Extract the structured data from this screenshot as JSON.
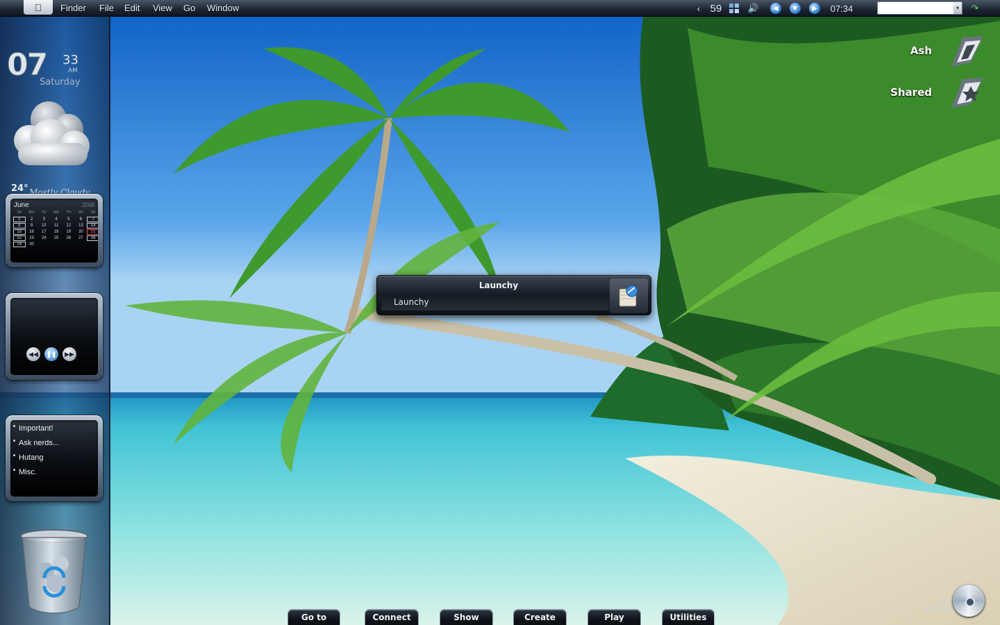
{
  "menubar": {
    "apple_icon": "apple-icon",
    "items": [
      "Finder",
      "File",
      "Edit",
      "View",
      "Go",
      "Window"
    ],
    "tray": {
      "count": "59",
      "clock": "07:34",
      "icons": [
        "chevron-left-icon",
        "spaces-icon",
        "volume-icon",
        "back-icon",
        "download-icon",
        "forward-icon",
        "refresh-icon"
      ]
    },
    "search": {
      "value": ""
    }
  },
  "clock_widget": {
    "hour": "07",
    "minute": "33",
    "ampm": "AM",
    "day": "Saturday"
  },
  "weather_widget": {
    "temp": "24°",
    "condition": "Mostly Cloudy"
  },
  "calendar_widget": {
    "month": "June",
    "year": "2008",
    "weekdays": [
      "SU",
      "MO",
      "TU",
      "WE",
      "TH",
      "FR",
      "SA"
    ],
    "weeks": [
      [
        "1",
        "2",
        "3",
        "4",
        "5",
        "6",
        "7"
      ],
      [
        "8",
        "9",
        "10",
        "11",
        "12",
        "13",
        "14"
      ],
      [
        "15",
        "16",
        "17",
        "18",
        "19",
        "20",
        "21"
      ],
      [
        "22",
        "23",
        "24",
        "25",
        "26",
        "27",
        "28"
      ],
      [
        "29",
        "30",
        "",
        "",
        "",
        "",
        ""
      ]
    ],
    "today": "21"
  },
  "player_widget": {
    "buttons": [
      "rewind-icon",
      "pause-icon",
      "fast-forward-icon"
    ]
  },
  "notes_widget": {
    "items": [
      "Important!",
      "Ask nerds...",
      "Hutang",
      "Misc."
    ]
  },
  "desktop": {
    "drives": [
      {
        "label": "Ash"
      },
      {
        "label": "Shared"
      }
    ],
    "disk": {
      "size": "4.35 GB"
    }
  },
  "launchy": {
    "title": "Launchy",
    "input_value": "Launchy"
  },
  "dock": {
    "tabs": [
      "Go to",
      "Connect",
      "Show",
      "Create",
      "Play",
      "Utilities"
    ]
  },
  "colors": {
    "accent": "#1f6ec2",
    "menubar": "#1b2532",
    "today": "#ff4b4b"
  }
}
